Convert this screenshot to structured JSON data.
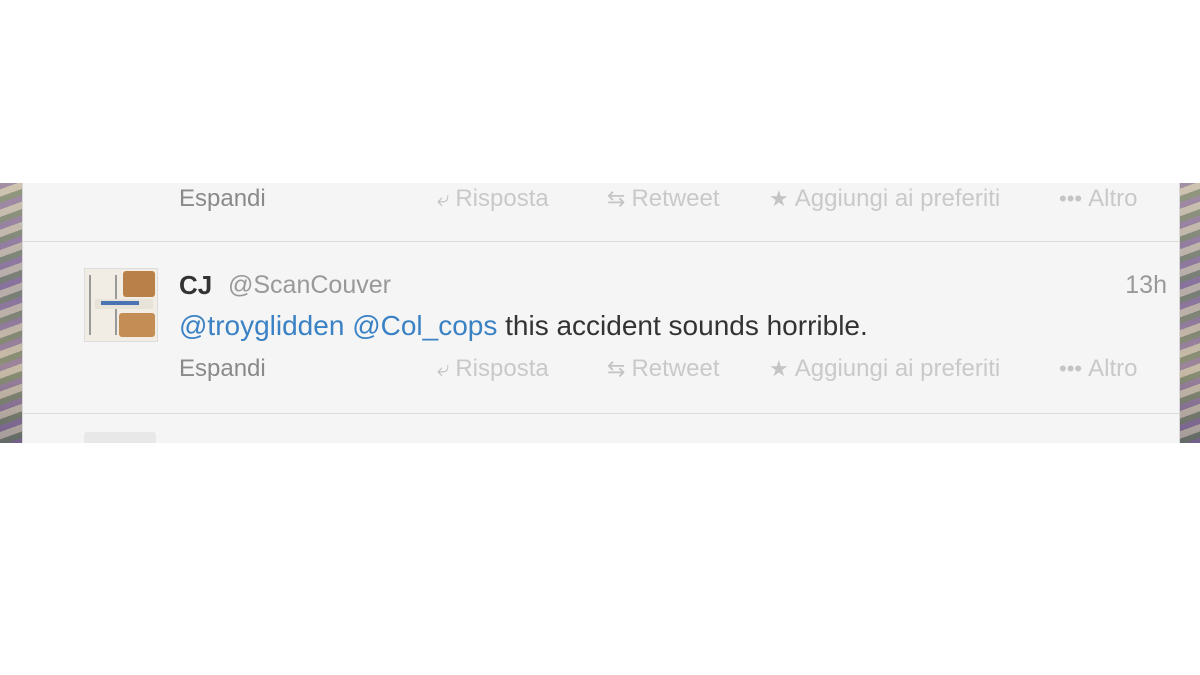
{
  "previous_tweet": {
    "expand_label": "Espandi",
    "actions": {
      "reply": "Risposta",
      "retweet": "Retweet",
      "favorite": "Aggiungi ai preferiti",
      "more": "Altro"
    }
  },
  "tweet": {
    "author_name": "CJ",
    "author_handle": "@ScanCouver",
    "time": "13h",
    "mention_1": "@troyglidden",
    "mention_2": "@Col_cops",
    "text": "this accident sounds horrible.",
    "expand_label": "Espandi",
    "actions": {
      "reply": "Risposta",
      "retweet": "Retweet",
      "favorite": "Aggiungi ai preferiti",
      "more": "Altro"
    }
  },
  "icons": {
    "reply": "reply-arrow-icon",
    "retweet": "retweet-icon",
    "favorite": "star-icon",
    "more": "more-dots-icon"
  },
  "colors": {
    "link": "#3a82c4",
    "text": "#333333",
    "muted": "#999999",
    "action_disabled": "#c9c9c9"
  }
}
